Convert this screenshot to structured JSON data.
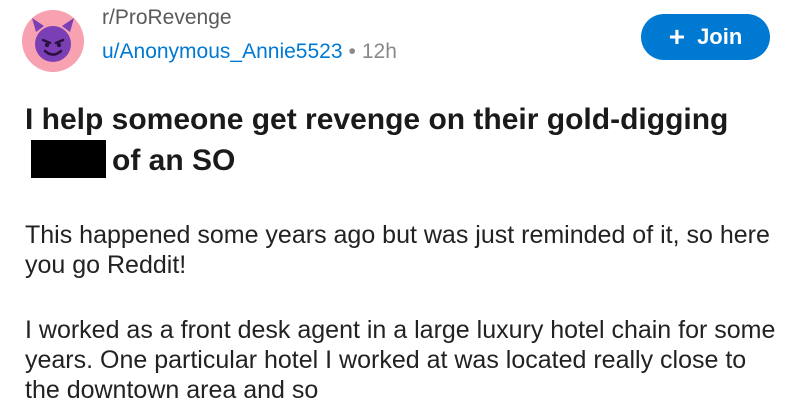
{
  "post": {
    "subreddit": "r/ProRevenge",
    "username": "u/Anonymous_Annie5523",
    "separator": "•",
    "age": "12h",
    "join_label": "Join",
    "join_icon": "plus-icon",
    "avatar_icon": "devil-face-icon",
    "title_part1": "I help someone get revenge on their gold-digging",
    "title_part2": "of an SO",
    "paragraphs": [
      "This happened some years ago but was just reminded of it, so here you go Reddit!",
      "I worked as a front desk agent in a large luxury hotel chain for some years. One particular hotel I worked at was located really close to the downtown area and so"
    ]
  },
  "colors": {
    "accent": "#0079d3",
    "avatar_bg": "#f7a1b1",
    "devil": "#7b3fb5"
  }
}
